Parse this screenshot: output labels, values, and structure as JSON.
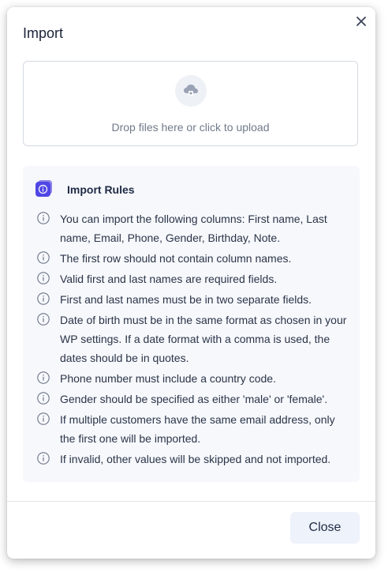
{
  "dialog": {
    "title": "Import",
    "close_icon": "close-icon"
  },
  "upload": {
    "icon": "cloud-upload-icon",
    "text": "Drop files here or click to upload"
  },
  "rules": {
    "icon": "info-badge-icon",
    "title": "Import Rules",
    "item_icon": "info-circle-icon",
    "items": [
      "You can import the following columns: First name, Last name, Email, Phone, Gender, Birthday, Note.",
      "The first row should not contain column names.",
      "Valid first and last names are required fields.",
      "First and last names must be in two separate fields.",
      "Date of birth must be in the same format as chosen in your WP settings. If a date format with a comma is used, the dates should be in quotes.",
      "Phone number must include a country code.",
      "Gender should be specified as either 'male' or 'female'.",
      "If multiple customers have the same email address, only the first one will be imported.",
      "If invalid, other values will be skipped and not imported."
    ]
  },
  "footer": {
    "close_label": "Close"
  },
  "colors": {
    "badge_purple": "#4f46e5",
    "badge_back": "#6a5fd8",
    "info_gray": "#6b7385",
    "text": "#2b3447",
    "rules_bg": "#f6f8fc"
  }
}
